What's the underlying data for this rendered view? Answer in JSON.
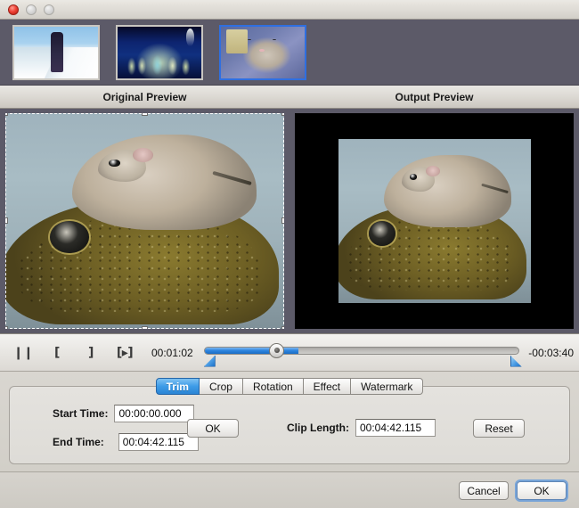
{
  "window": {
    "controls": [
      {
        "name": "close",
        "color": "#ef4136"
      },
      {
        "name": "minimize",
        "color": "#d8d8d8"
      },
      {
        "name": "maximize",
        "color": "#d8d8d8"
      }
    ]
  },
  "thumbnails": [
    {
      "name": "thumb-skier",
      "selected": false
    },
    {
      "name": "thumb-stage",
      "selected": false
    },
    {
      "name": "thumb-kitten",
      "selected": true
    }
  ],
  "preview": {
    "original_label": "Original Preview",
    "output_label": "Output Preview"
  },
  "transport": {
    "buttons": [
      {
        "name": "pause-button",
        "glyph": "❙❙"
      },
      {
        "name": "set-in-point-button",
        "glyph": "["
      },
      {
        "name": "set-out-point-button",
        "glyph": "]"
      },
      {
        "name": "play-selection-button",
        "glyph": "[▸]"
      }
    ],
    "current_time": "00:01:02",
    "remaining_time": "-00:03:40",
    "progress_percent": 30,
    "knob_percent": 23,
    "trim_start_percent": 0,
    "trim_end_percent": 97
  },
  "tabs": [
    {
      "label": "Trim",
      "active": true
    },
    {
      "label": "Crop",
      "active": false
    },
    {
      "label": "Rotation",
      "active": false
    },
    {
      "label": "Effect",
      "active": false
    },
    {
      "label": "Watermark",
      "active": false
    }
  ],
  "trim_form": {
    "start_time_label": "Start Time:",
    "start_time_value": "00:00:00.000",
    "end_time_label": "End Time:",
    "end_time_value": "00:04:42.115",
    "ok_label": "OK",
    "clip_length_label": "Clip Length:",
    "clip_length_value": "00:04:42.115",
    "reset_label": "Reset"
  },
  "footer": {
    "cancel_label": "Cancel",
    "ok_label": "OK"
  }
}
